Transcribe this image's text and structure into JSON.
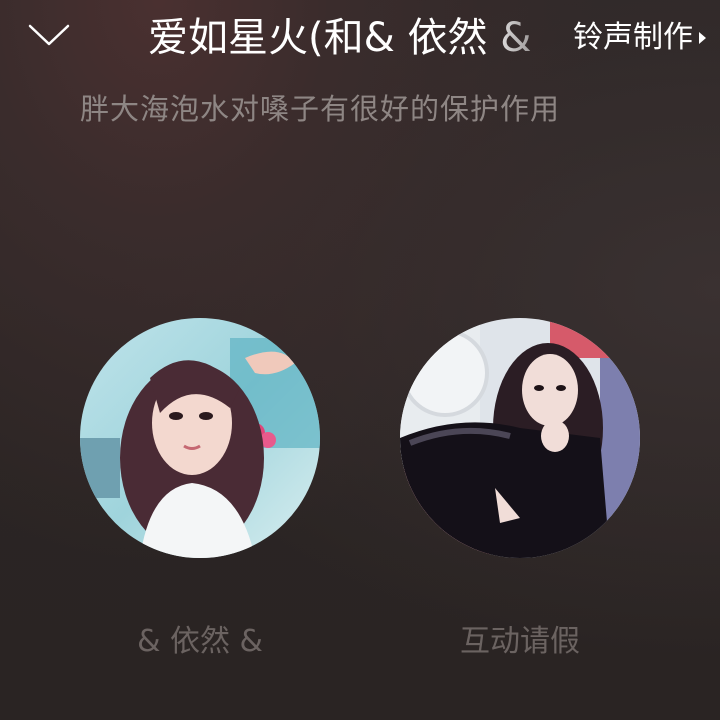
{
  "header": {
    "collapse_icon": "chevron-down-icon",
    "song_title": "爱如星火(和& 依然 &",
    "ringtone_label": "铃声制作",
    "ringtone_icon": "arrow-right-icon"
  },
  "subtitle": "胖大海泡水对嗓子有很好的保护作用",
  "singers": [
    {
      "name": "& 依然 &"
    },
    {
      "name": "互动请假"
    }
  ],
  "colors": {
    "background": "#2b2524",
    "subtitle_text": "#8e8684",
    "name_text": "#6b6361",
    "title_text": "#ffffff"
  }
}
